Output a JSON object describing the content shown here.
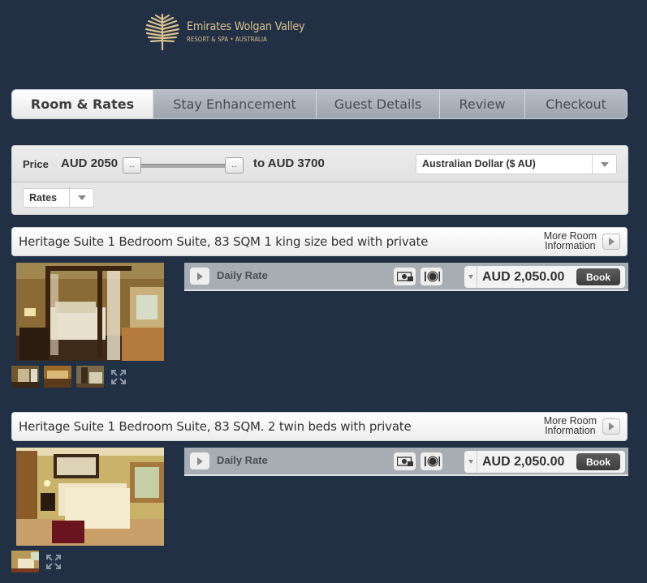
{
  "brand": {
    "name": "Emirates Wolgan Valley",
    "tagline": "RESORT & SPA • AUSTRALIA",
    "accent_color": "#d9c08e",
    "logo_icon": "palm-leaf-icon"
  },
  "tabs": [
    {
      "label": "Room & Rates",
      "active": true
    },
    {
      "label": "Stay Enhancement",
      "active": false
    },
    {
      "label": "Guest Details",
      "active": false
    },
    {
      "label": "Review",
      "active": false
    },
    {
      "label": "Checkout",
      "active": false
    }
  ],
  "filter": {
    "price_label": "Price",
    "price_min": "AUD 2050",
    "price_max": "to AUD 3700",
    "slider_range": {
      "min": 2050,
      "max": 3700
    },
    "currency_selected": "Australian Dollar ($ AU)",
    "rates_selected": "Rates"
  },
  "rooms": [
    {
      "title": "Heritage Suite 1 Bedroom Suite, 83 SQM 1 king size bed with private",
      "more_info_line1": "More Room",
      "more_info_line2": "Information",
      "photo": "room-photo-king-bed",
      "thumbnail_count": 3,
      "rate": {
        "label": "Daily Rate",
        "price": "AUD 2,050.00",
        "book_label": "Book",
        "amenities": [
          "money-icon",
          "meal-icon"
        ]
      }
    },
    {
      "title": "Heritage Suite 1 Bedroom Suite, 83 SQM. 2 twin beds with private",
      "more_info_line1": "More Room",
      "more_info_line2": "Information",
      "photo": "room-photo-twin-beds",
      "thumbnail_count": 1,
      "rate": {
        "label": "Daily Rate",
        "price": "AUD 2,050.00",
        "book_label": "Book",
        "amenities": [
          "money-icon",
          "meal-icon"
        ]
      }
    }
  ]
}
